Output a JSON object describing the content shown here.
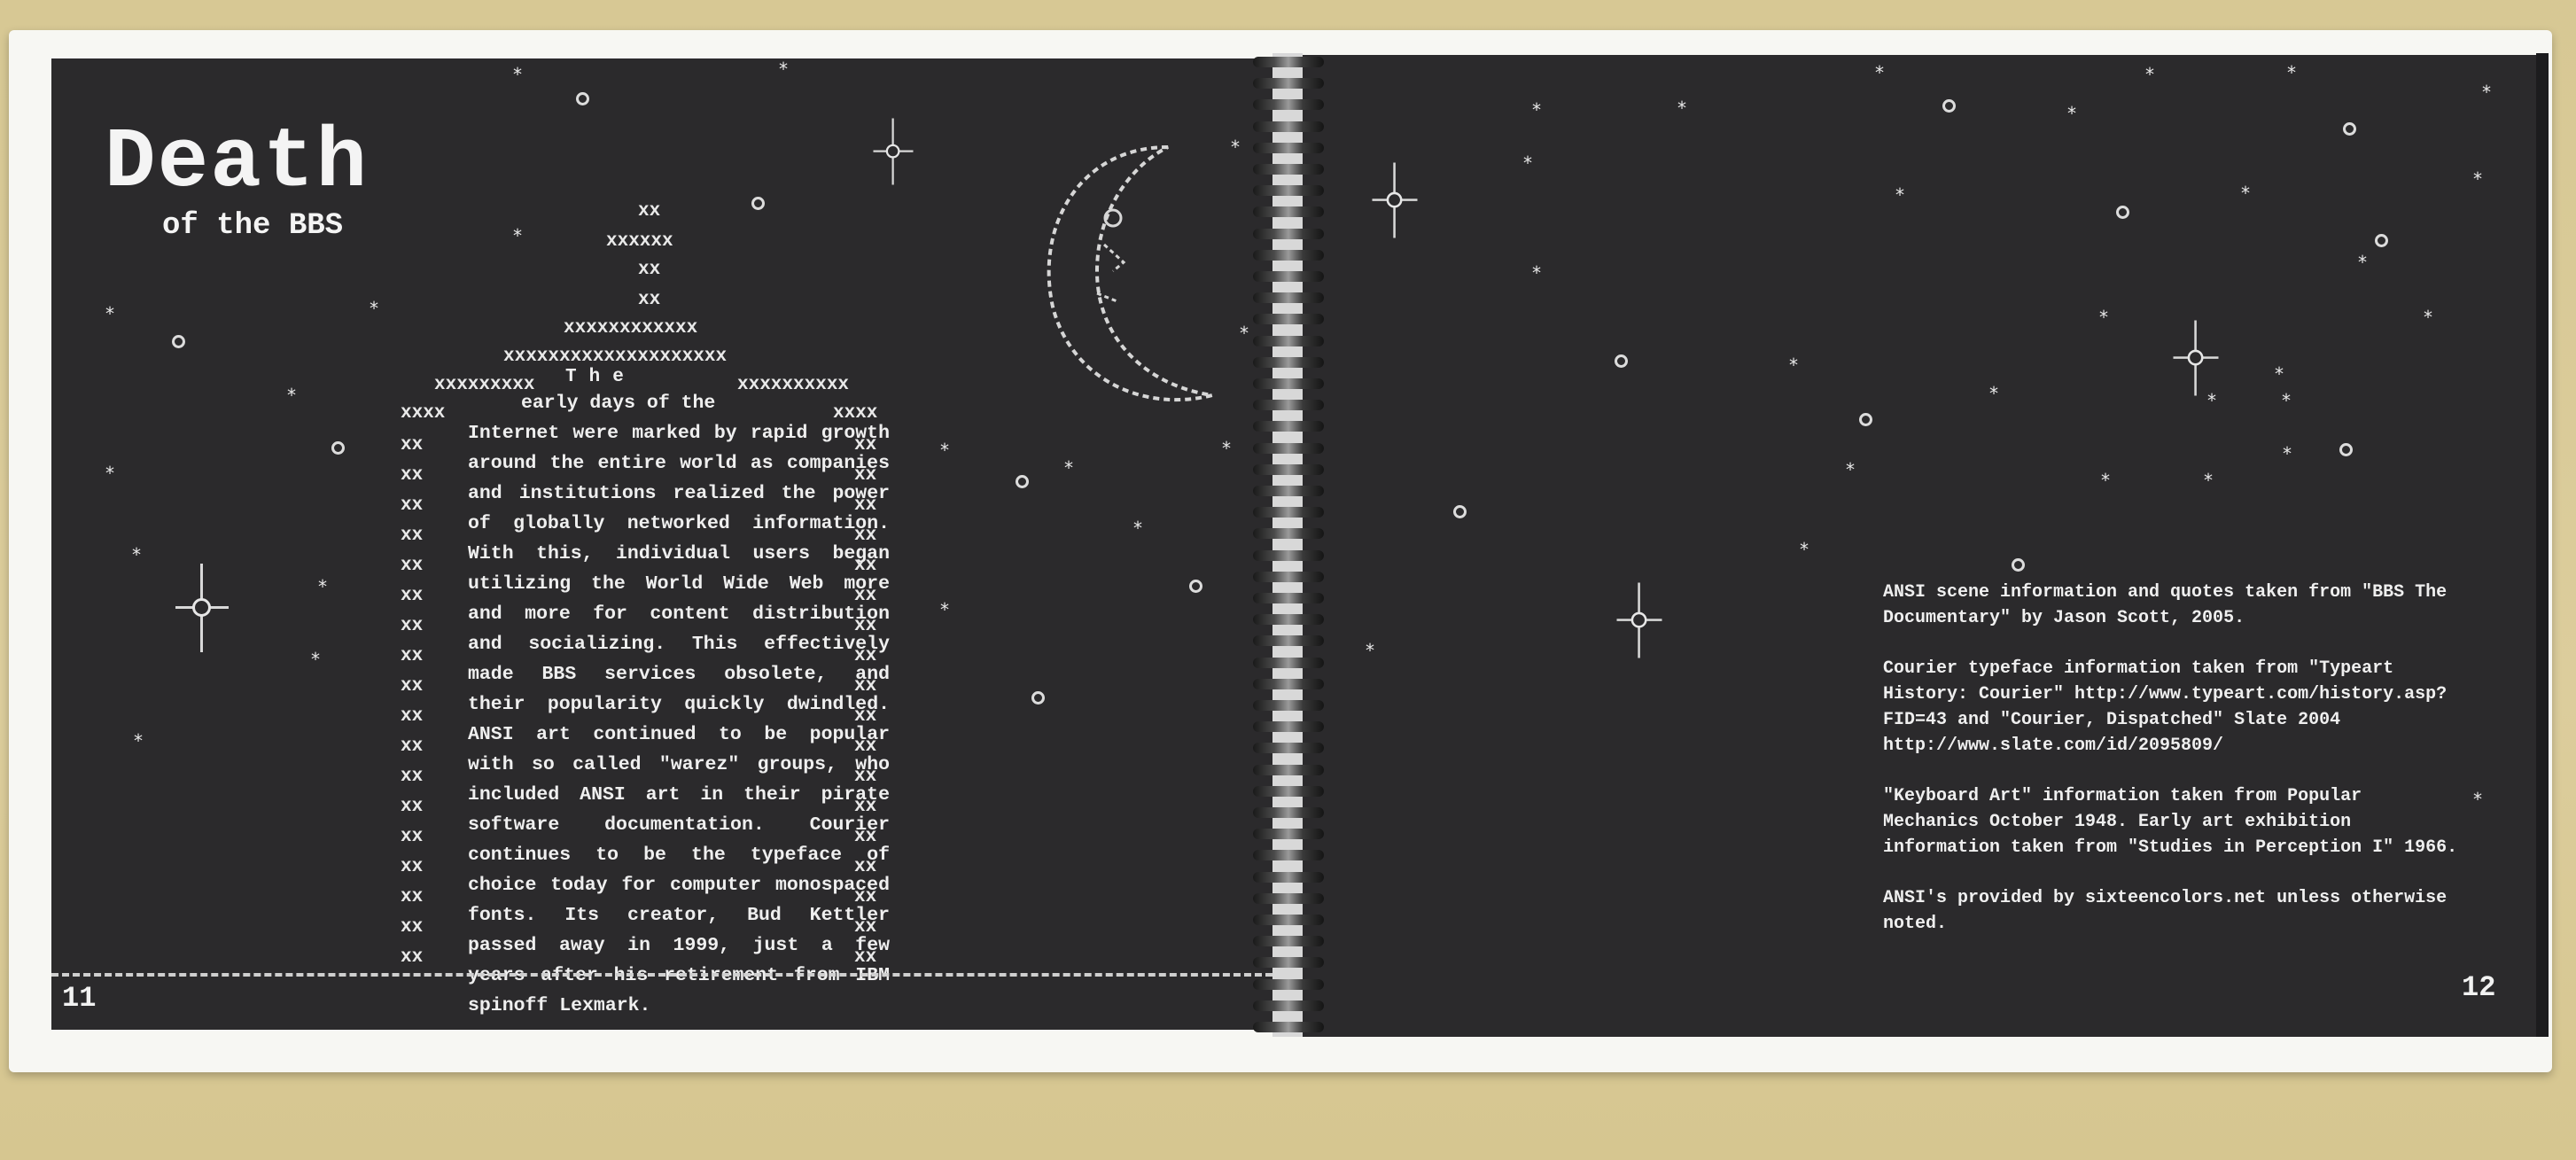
{
  "left_page": {
    "title": "Death",
    "subtitle": "of the BBS",
    "t_letters": "The",
    "body_lead": "early days of the",
    "body_text": "Internet were marked by rapid growth around the entire world as companies and institutions realized the power of globally networked information. With this, individual users began utilizing the World Wide Web more and more for content distribution and socializing. This effectively made BBS services obsolete, and their popularity quickly dwindled. ANSI art continued to be popular with so called \"warez\" groups, who included ANSI art in their pirate software documentation. Courier continues to be the typeface of choice today for computer monospaced fonts. Its creator, Bud Kettler passed away in 1999, just a few years after his retirement from IBM spinoff Lexmark.",
    "art_rows": [
      "xx",
      "xxxxxx",
      "xx",
      "xx",
      "xxxxxxxxxxxx",
      "xxxxxxxxxxxxxxxxxxxx"
    ],
    "art_left_shoulder": "xxxxxxxxx",
    "art_right_shoulder": "xxxxxxxxxx",
    "art_wall_top": "xxxx",
    "art_wall_cell": "xx",
    "page_number": "11"
  },
  "right_page": {
    "credits": [
      "ANSI scene information and quotes taken from \"BBS The Documentary\" by Jason Scott, 2005.",
      "Courier typeface information taken from \"Typeart History: Courier\" http://www.typeart.com/history.asp?FID=43 and \"Courier, Dispatched\" Slate 2004 http://www.slate.com/id/2095809/",
      "\"Keyboard Art\" information taken from Popular Mechanics October 1948. Early art exhibition information taken from \"Studies in Perception I\" 1966.",
      "ANSI's provided by sixteencolors.net unless otherwise noted."
    ],
    "page_number": "12"
  },
  "colors": {
    "page": "#2b2a2c",
    "ink": "#efefef",
    "paper": "#f7f7f3",
    "table": "#d9ca98"
  }
}
